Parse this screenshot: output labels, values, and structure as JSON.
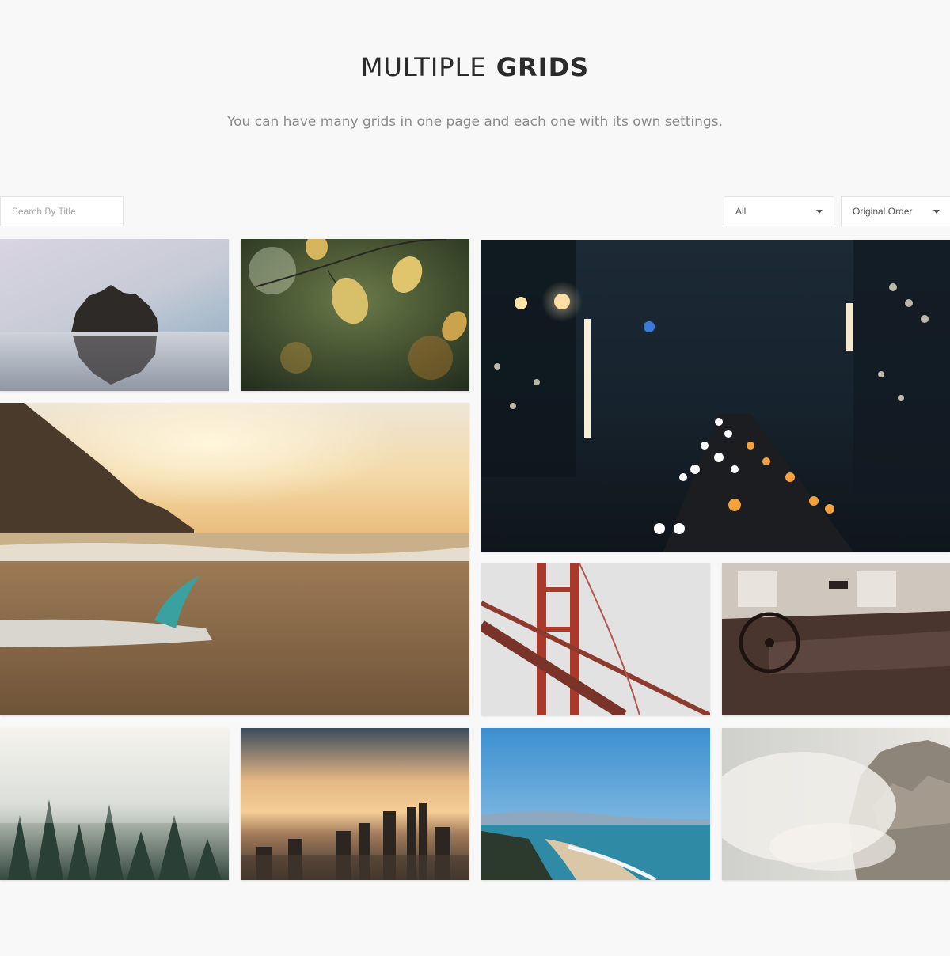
{
  "header": {
    "title_light": "MULTIPLE",
    "title_bold": "GRIDS",
    "subtitle": "You can have many grids in one page and each one with its own settings."
  },
  "toolbar": {
    "search_placeholder": "Search By Title",
    "category_selected": "All",
    "order_selected": "Original Order"
  },
  "gallery": {
    "items": [
      {
        "name": "rock-island-reflection"
      },
      {
        "name": "autumn-leaves"
      },
      {
        "name": "city-night-traffic"
      },
      {
        "name": "beach-sunset-surfboard"
      },
      {
        "name": "golden-gate-bridge-fog"
      },
      {
        "name": "vintage-car-interior"
      },
      {
        "name": "misty-forest"
      },
      {
        "name": "city-skyline-sunset"
      },
      {
        "name": "coastal-beach-aerial"
      },
      {
        "name": "cliff-in-clouds"
      }
    ]
  }
}
